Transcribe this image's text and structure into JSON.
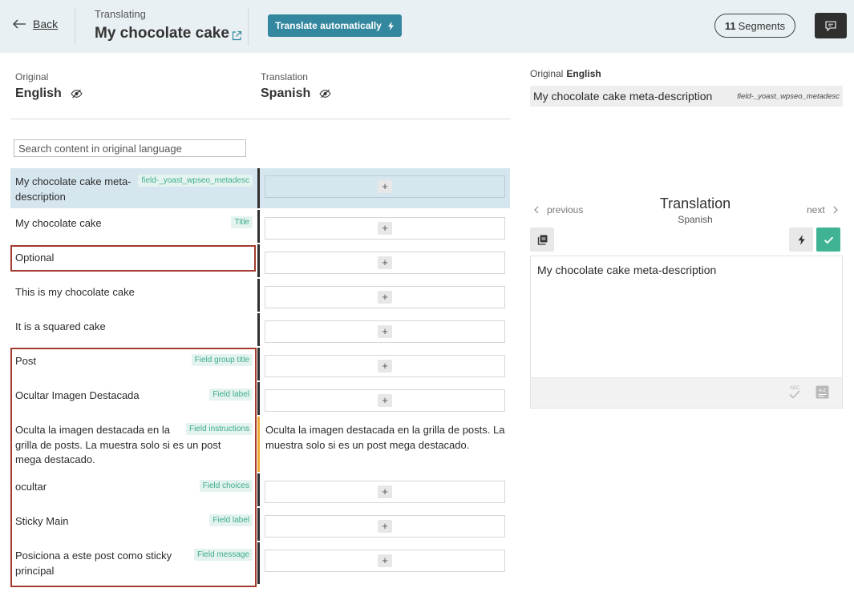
{
  "header": {
    "back_label": "Back",
    "translating_label": "Translating",
    "doc_title": "My chocolate cake",
    "auto_translate_label": "Translate automatically",
    "segments_count": "11",
    "segments_label": "Segments"
  },
  "columns": {
    "original_caption": "Original",
    "original_language": "English",
    "translation_caption": "Translation",
    "translation_language": "Spanish"
  },
  "search": {
    "placeholder": "Search content in original language"
  },
  "segments": [
    {
      "text": "My chocolate cake meta-description",
      "tag": "field-_yoast_wpseo_metadesc",
      "translation": ""
    },
    {
      "text": "My chocolate cake",
      "tag": "Title",
      "translation": ""
    },
    {
      "text": "Optional",
      "tag": "",
      "translation": ""
    },
    {
      "text": "This is my chocolate cake",
      "tag": "",
      "translation": ""
    },
    {
      "text": "It is a squared cake",
      "tag": "",
      "translation": ""
    },
    {
      "text": "Post",
      "tag": "Field group title",
      "translation": ""
    },
    {
      "text": "Ocultar Imagen Destacada",
      "tag": "Field label",
      "translation": ""
    },
    {
      "text": "Oculta la imagen destacada en la grilla de posts. La muestra solo si es un post mega destacado.",
      "tag": "Field instructions",
      "translation": "Oculta la imagen destacada en la grilla de posts. La muestra solo si es un post mega destacado."
    },
    {
      "text": "ocultar",
      "tag": "Field choices",
      "translation": ""
    },
    {
      "text": "Sticky Main",
      "tag": "Field label",
      "translation": ""
    },
    {
      "text": "Posiciona a este post como sticky principal",
      "tag": "Field message",
      "translation": ""
    }
  ],
  "plus_label": "+",
  "panel": {
    "original_caption": "Original",
    "original_language": "English",
    "original_text": "My chocolate cake meta-description",
    "original_field": "field-_yoast_wpseo_metadesc",
    "previous_label": "previous",
    "next_label": "next",
    "title": "Translation",
    "language": "Spanish",
    "editor_value": "My chocolate cake meta-description",
    "spell_label": "ABC",
    "glossary_label": "A-Z"
  },
  "colors": {
    "header_bg": "#e9f0f3",
    "accent_button": "#33879e",
    "approve_green": "#3fb394",
    "tag_green": "#3cac8f",
    "active_row": "#d6e6ef",
    "partial_bar": "#f0a93b",
    "highlight_box": "#a33b2e"
  }
}
